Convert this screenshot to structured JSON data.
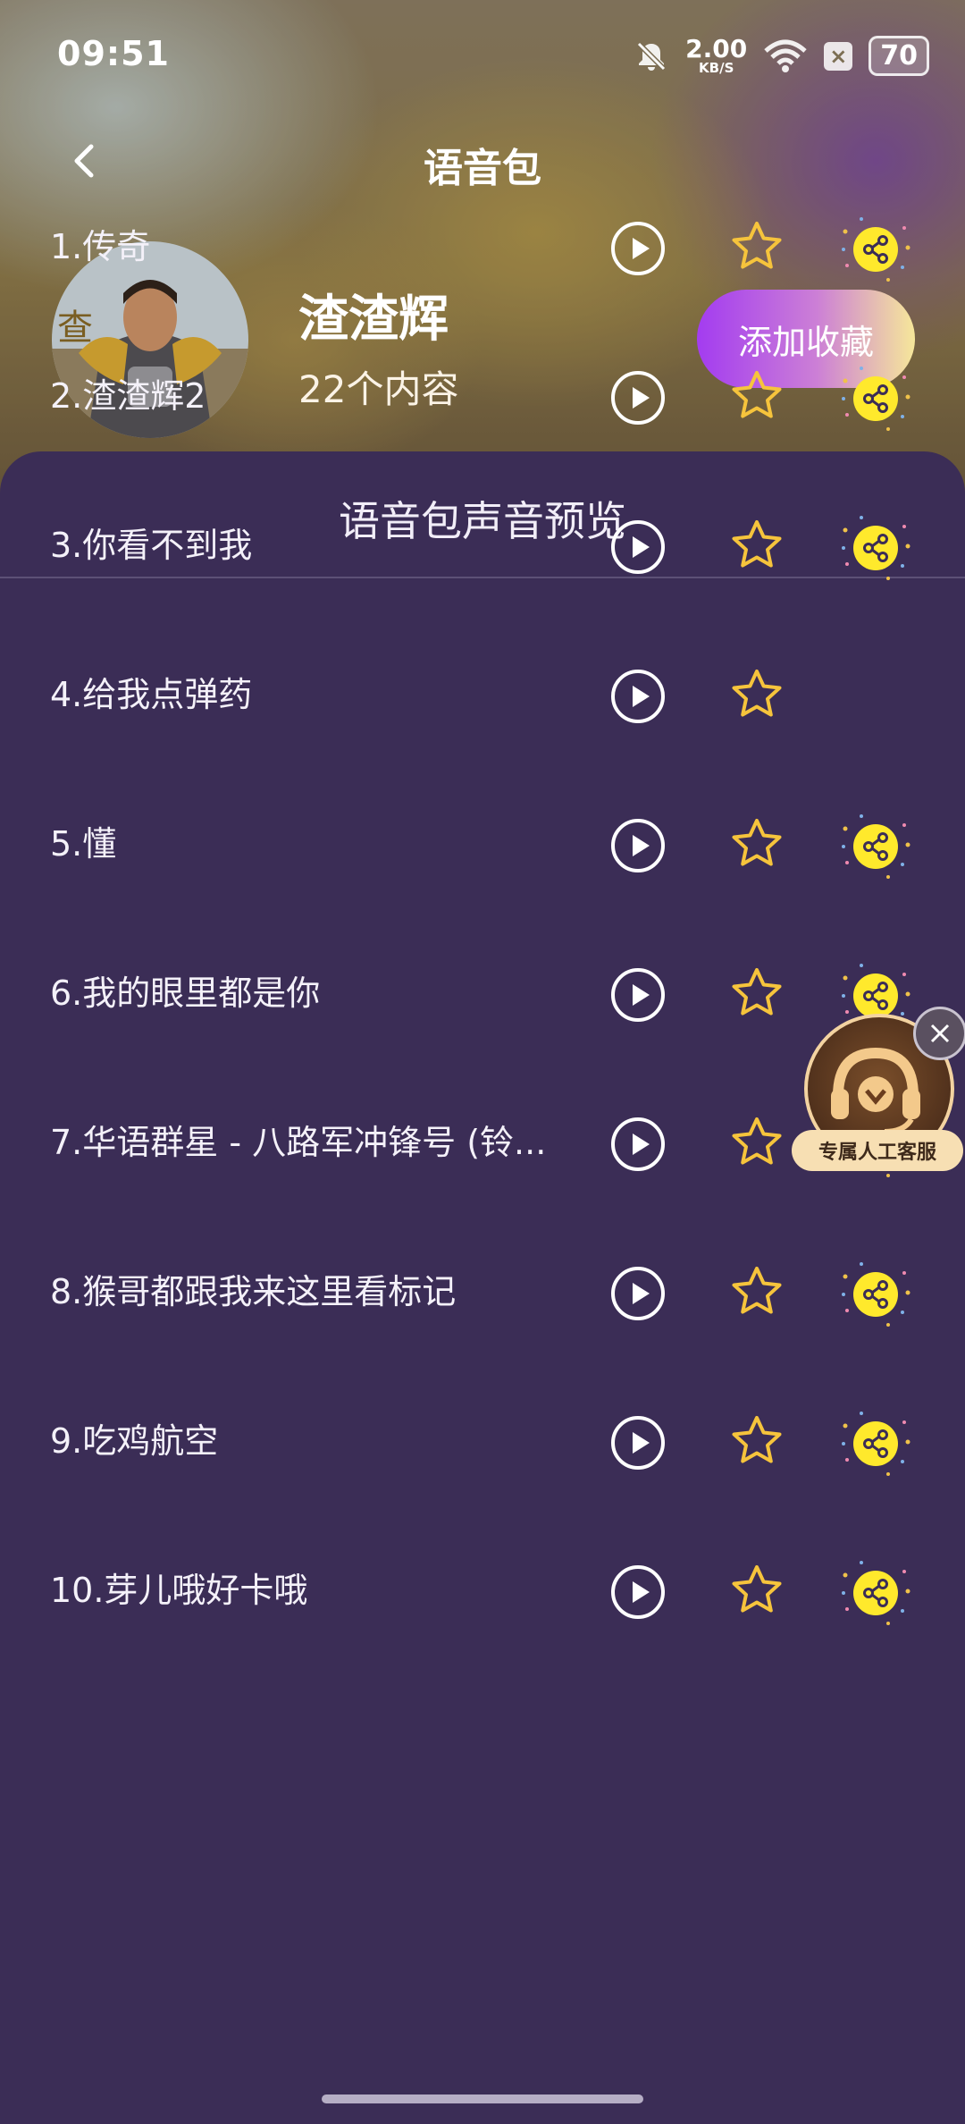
{
  "status_bar": {
    "time": "09:51",
    "net_speed_value": "2.00",
    "net_speed_unit": "KB/S",
    "battery": "70"
  },
  "header": {
    "title": "语音包"
  },
  "profile": {
    "name": "渣渣辉",
    "count_text": "22个内容",
    "favorite_button": "添加收藏"
  },
  "sheet": {
    "title": "语音包声音预览",
    "items": [
      {
        "label": "1.传奇"
      },
      {
        "label": "2.渣渣辉2"
      },
      {
        "label": "3.你看不到我"
      },
      {
        "label": "4.给我点弹药"
      },
      {
        "label": "5.懂"
      },
      {
        "label": "6.我的眼里都是你"
      },
      {
        "label": "7.华语群星 - 八路军冲锋号 (铃..."
      },
      {
        "label": "8.猴哥都跟我来这里看标记"
      },
      {
        "label": "9.吃鸡航空"
      },
      {
        "label": "10.芽儿哦好卡哦"
      }
    ]
  },
  "customer_service": {
    "label": "专属人工客服"
  },
  "colors": {
    "sheet_bg": "#3b2d56",
    "star": "#f6c43c",
    "share_bg": "#ffe92c",
    "accent_purple": "#a33cf0"
  }
}
